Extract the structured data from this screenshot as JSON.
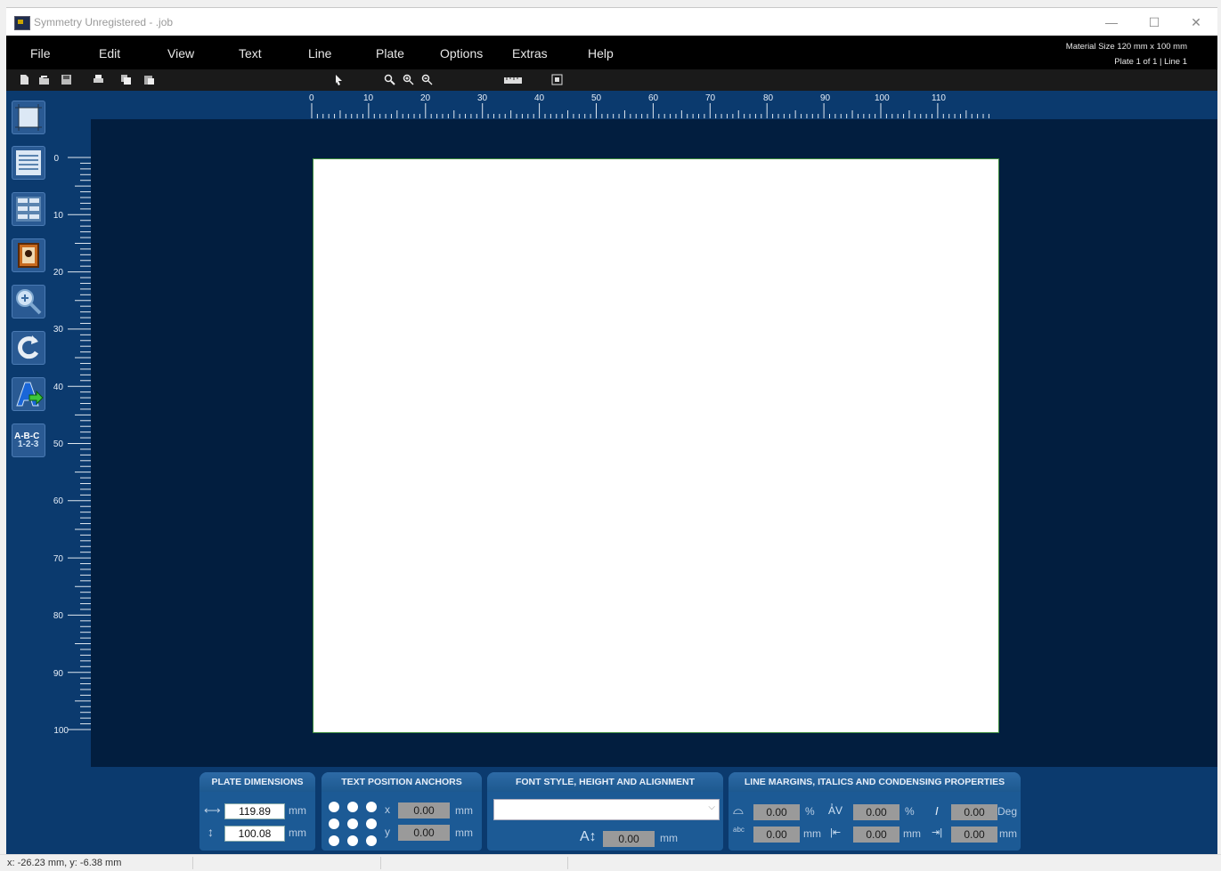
{
  "window": {
    "title": "Symmetry Unregistered  -  .job",
    "minimize_glyph": "—",
    "maximize_glyph": "☐",
    "close_glyph": "✕"
  },
  "menu": {
    "items": [
      "File",
      "Edit",
      "View",
      "Text",
      "Line",
      "Plate",
      "Options",
      "Extras",
      "Help"
    ]
  },
  "status_info": {
    "material_size": "Material Size 120 mm x 100 mm",
    "plate_line": "Plate  1 of 1  |  Line 1"
  },
  "toolbar": {
    "icons": [
      "new-file-icon",
      "open-file-icon",
      "save-icon",
      "print-icon",
      "copy-icon",
      "paste-icon",
      "pointer-icon",
      "zoom-icon",
      "zoom-in-icon",
      "zoom-out-icon",
      "ruler-icon",
      "fit-icon"
    ]
  },
  "rulers": {
    "horizontal": [
      "0",
      "10",
      "20",
      "30",
      "40",
      "50",
      "60",
      "70",
      "80",
      "90",
      "100",
      "110"
    ],
    "vertical": [
      "0",
      "10",
      "20",
      "30",
      "40",
      "50",
      "60",
      "70",
      "80",
      "90",
      "100"
    ]
  },
  "tools": {
    "icons": [
      "plate-size-icon",
      "lines-icon",
      "grid-layout-icon",
      "image-icon",
      "zoom-tool-icon",
      "rotate-icon",
      "text-add-icon",
      "sequence-icon"
    ],
    "sequence_label_1": "A-B-C",
    "sequence_label_2": "1-2-3"
  },
  "plate_dimensions": {
    "title": "PLATE DIMENSIONS",
    "width": "119.89",
    "height": "100.08",
    "unit": "mm"
  },
  "text_anchors": {
    "title": "TEXT POSITION ANCHORS",
    "x_label": "x",
    "y_label": "y",
    "x_value": "0.00",
    "y_value": "0.00",
    "unit": "mm"
  },
  "font_style": {
    "title": "FONT STYLE, HEIGHT AND ALIGNMENT",
    "font_value": "",
    "height_value": "0.00",
    "unit": "mm"
  },
  "line_margins": {
    "title": "LINE MARGINS, ITALICS AND CONDENSING PROPERTIES",
    "arc_value": "0.00",
    "arc_unit": "%",
    "arc2_value": "0.00",
    "arc2_unit": "mm",
    "spacing_value": "0.00",
    "spacing_unit": "%",
    "indent_value": "0.00",
    "indent_unit": "mm",
    "italic_value": "0.00",
    "italic_unit": "Deg",
    "right_value": "0.00",
    "right_unit": "mm"
  },
  "statusbar": {
    "coords": "x:   -26.23 mm, y:     -6.38 mm"
  },
  "colors": {
    "work_area": "#0b3a6e",
    "canvas": "#021e3f",
    "plate": "#ffffff",
    "menubar": "#000000"
  }
}
